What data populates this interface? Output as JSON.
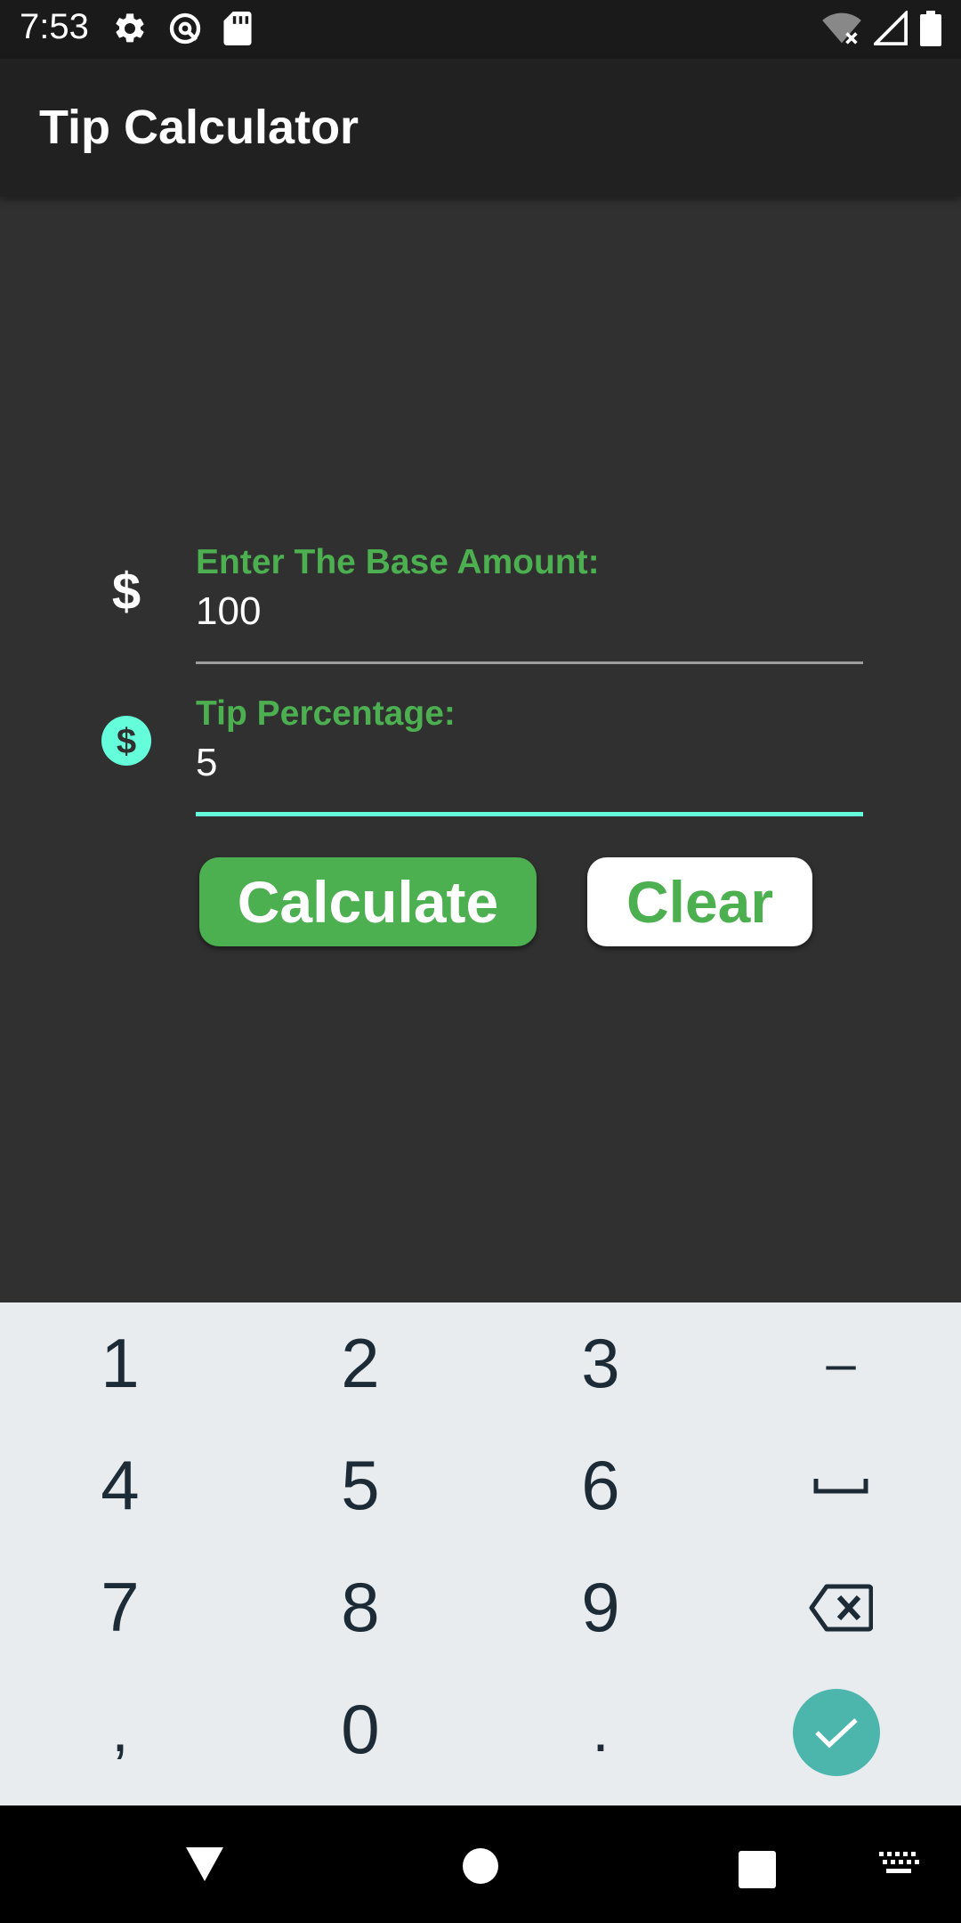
{
  "status_bar": {
    "time": "7:53",
    "left_icons": [
      "settings-icon",
      "no-disturb-icon",
      "sd-card-icon"
    ],
    "right_icons": [
      "wifi-off-icon",
      "cell-signal-icon",
      "battery-icon"
    ]
  },
  "app_bar": {
    "title": "Tip Calculator"
  },
  "form": {
    "base_amount": {
      "label": "Enter The Base Amount:",
      "value": "100",
      "icon": "dollar-icon"
    },
    "tip_percentage": {
      "label": "Tip Percentage:",
      "value": "5",
      "icon": "dollar-circle-icon"
    }
  },
  "buttons": {
    "calculate": "Calculate",
    "clear": "Clear"
  },
  "keyboard": {
    "keys": [
      "1",
      "2",
      "3",
      "–",
      "4",
      "5",
      "6",
      "␣",
      "7",
      "8",
      "9",
      "⌫",
      ",",
      "0",
      "."
    ],
    "done_icon": "check-icon"
  },
  "nav_bar": {
    "icons": [
      "back-icon",
      "home-icon",
      "recents-icon",
      "keyboard-switch-icon"
    ]
  },
  "colors": {
    "accent": "#4caf50",
    "focus_line": "#64ffda",
    "keyboard_bg": "#e8ecef",
    "done_key": "#4db6ac"
  }
}
